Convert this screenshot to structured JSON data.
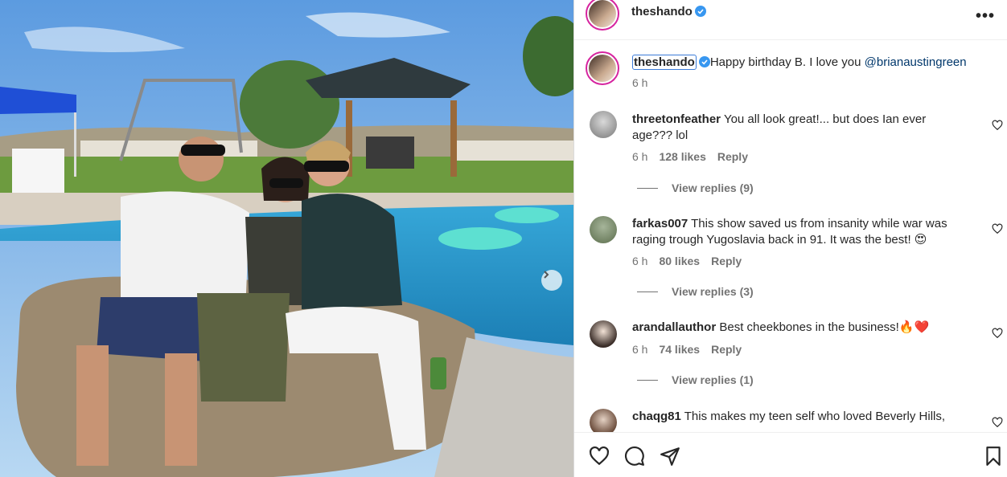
{
  "post": {
    "author": "theshando",
    "caption_user": "theshando",
    "caption_text": "Happy birthday B. I love you ",
    "caption_mention": "@brianaustingreen",
    "caption_time": "6 h"
  },
  "comments": [
    {
      "user": "threetonfeather",
      "text_line1": "You all look great!... but does Ian ever",
      "text_line2": "age??? lol",
      "time": "6 h",
      "likes": "128 likes",
      "reply": "Reply",
      "view_replies": "View replies (9)"
    },
    {
      "user": "farkas007",
      "text_line1": "This show saved us from insanity while war was",
      "text_line2": "raging trough Yugoslavia back in 91. It was the best! 😍",
      "time": "6 h",
      "likes": "80 likes",
      "reply": "Reply",
      "view_replies": "View replies (3)"
    },
    {
      "user": "arandallauthor",
      "text_line1": "Best cheekbones in the business!🔥❤️",
      "time": "6 h",
      "likes": "74 likes",
      "reply": "Reply",
      "view_replies": "View replies (1)"
    },
    {
      "user": "chaqg81",
      "text_line1": "This makes my teen self who loved Beverly Hills,"
    }
  ],
  "icons": {
    "verified": "verified-badge-icon",
    "more": "more-options-icon",
    "next": "chevron-right-icon",
    "like": "heart-icon",
    "comment": "comment-icon",
    "share": "share-icon",
    "save": "bookmark-icon"
  },
  "colors": {
    "verified": "#3897f0",
    "mention": "#00376b",
    "muted": "#737373",
    "focus_outline": "#3b7bd8"
  }
}
